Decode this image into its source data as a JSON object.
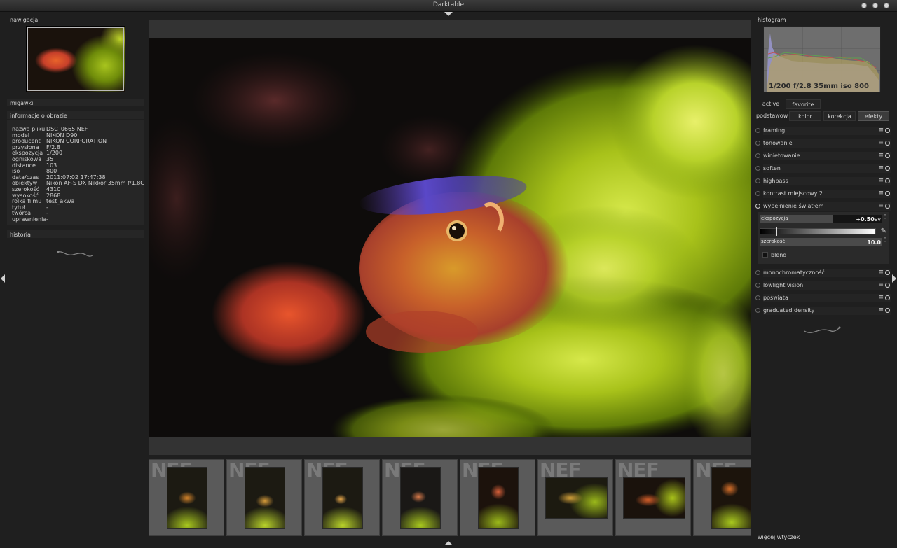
{
  "window": {
    "title": "Darktable"
  },
  "left_panel": {
    "navigation_label": "nawigacja",
    "snapshots_label": "migawki",
    "image_info_label": "informacje o obrazie",
    "history_label": "historia",
    "image_info": [
      {
        "key": "nazwa pliku",
        "value": "DSC_0665.NEF"
      },
      {
        "key": "model",
        "value": "NIKON D90"
      },
      {
        "key": "producent",
        "value": "NIKON CORPORATION"
      },
      {
        "key": "przysłona",
        "value": "F/2.8"
      },
      {
        "key": "ekspozycja",
        "value": "1/200"
      },
      {
        "key": "ogniskowa",
        "value": "35"
      },
      {
        "key": "distance",
        "value": "103"
      },
      {
        "key": "iso",
        "value": "800"
      },
      {
        "key": "data/czas",
        "value": "2011:07:02 17:47:38"
      },
      {
        "key": "obiektyw",
        "value": "Nikon AF-S DX Nikkor 35mm f/1.8G"
      },
      {
        "key": "szerokość",
        "value": "4310"
      },
      {
        "key": "wysokość",
        "value": "2868"
      },
      {
        "key": "rolka filmu",
        "value": "test_akwa"
      },
      {
        "key": "tytuł",
        "value": "-"
      },
      {
        "key": "twórca",
        "value": "-"
      },
      {
        "key": "uprawnienia",
        "value": "-"
      }
    ]
  },
  "right_panel": {
    "histogram_label": "histogram",
    "histogram_exif": "1/200 f/2.8 35mm iso 800",
    "tabs_row1": [
      "active",
      "favorite"
    ],
    "tabs_row2": [
      "podstawow",
      "kolor",
      "korekcja",
      "efekty"
    ],
    "active_group_tab": "efekty",
    "modules": [
      {
        "name": "framing",
        "enabled": false
      },
      {
        "name": "tonowanie",
        "enabled": false
      },
      {
        "name": "winietowanie",
        "enabled": false
      },
      {
        "name": "soften",
        "enabled": false
      },
      {
        "name": "highpass",
        "enabled": false
      },
      {
        "name": "kontrast miejscowy 2",
        "enabled": false
      },
      {
        "name": "wypełnienie światłem",
        "enabled": true,
        "expanded": true
      },
      {
        "name": "monochromatyczność",
        "enabled": false
      },
      {
        "name": "lowlight vision",
        "enabled": false
      },
      {
        "name": "poświata",
        "enabled": false
      },
      {
        "name": "graduated density",
        "enabled": false
      }
    ],
    "fill_light": {
      "exposure_label": "ekspozycja",
      "exposure_value": "+0.50",
      "exposure_unit": "EV",
      "exposure_fraction": 0.6,
      "center_fraction": 0.14,
      "width_label": "szerokość",
      "width_value": "10.0",
      "width_fraction": 1.0,
      "blend_label": "blend"
    },
    "more_plugins_label": "więcej wtyczek"
  },
  "filmstrip": {
    "badge": "NEF",
    "count": 8
  },
  "colors": {
    "panel_bg": "#1f1f1f",
    "section_bg": "#262626",
    "filmstrip_cell": "#5a5a5a"
  }
}
